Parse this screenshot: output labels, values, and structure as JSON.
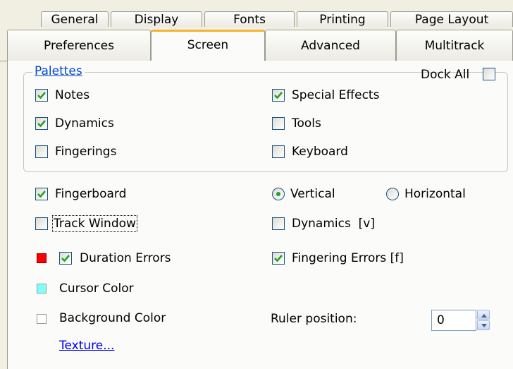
{
  "tabs_row1": [
    {
      "label": "General"
    },
    {
      "label": "Display"
    },
    {
      "label": "Fonts"
    },
    {
      "label": "Printing"
    },
    {
      "label": "Page Layout"
    }
  ],
  "tabs_row2": [
    {
      "label": "Preferences"
    },
    {
      "label": "Screen",
      "active": true
    },
    {
      "label": "Advanced"
    },
    {
      "label": "Multitrack"
    }
  ],
  "palettes": {
    "group_label": "Palettes",
    "dock_all_label": "Dock All",
    "dock_all_checked": false,
    "items": [
      {
        "label": "Notes",
        "checked": true
      },
      {
        "label": "Dynamics",
        "checked": true
      },
      {
        "label": "Fingerings",
        "checked": false
      },
      {
        "label": "Special Effects",
        "checked": true
      },
      {
        "label": "Tools",
        "checked": false
      },
      {
        "label": "Keyboard",
        "checked": false
      }
    ]
  },
  "options": {
    "fingerboard": {
      "label": "Fingerboard",
      "checked": true
    },
    "orientation_vertical": {
      "label": "Vertical",
      "selected": true
    },
    "orientation_horizontal": {
      "label": "Horizontal",
      "selected": false
    },
    "track_window": {
      "label": "Track Window",
      "checked": false
    },
    "dynamics_v": {
      "label": "Dynamics  [v]",
      "checked": false
    },
    "duration_errors": {
      "label": "Duration Errors",
      "checked": true,
      "color": "#ff0000"
    },
    "fingering_errors": {
      "label": "Fingering Errors [f]",
      "checked": true
    },
    "cursor_color": {
      "label": "Cursor Color",
      "color": "#80ffff"
    },
    "background_color": {
      "label": "Background Color",
      "color": "#ffffff"
    },
    "texture_link": "Texture...",
    "ruler_position": {
      "label": "Ruler position:",
      "value": "0"
    }
  },
  "icons": {
    "checkmark": "check-icon",
    "spin_up": "up-arrow-icon",
    "spin_down": "down-arrow-icon"
  },
  "colors": {
    "accent_tab": "#f6b330",
    "group_label": "#0046d5",
    "check": "#21a121",
    "link": "#0000ee"
  }
}
